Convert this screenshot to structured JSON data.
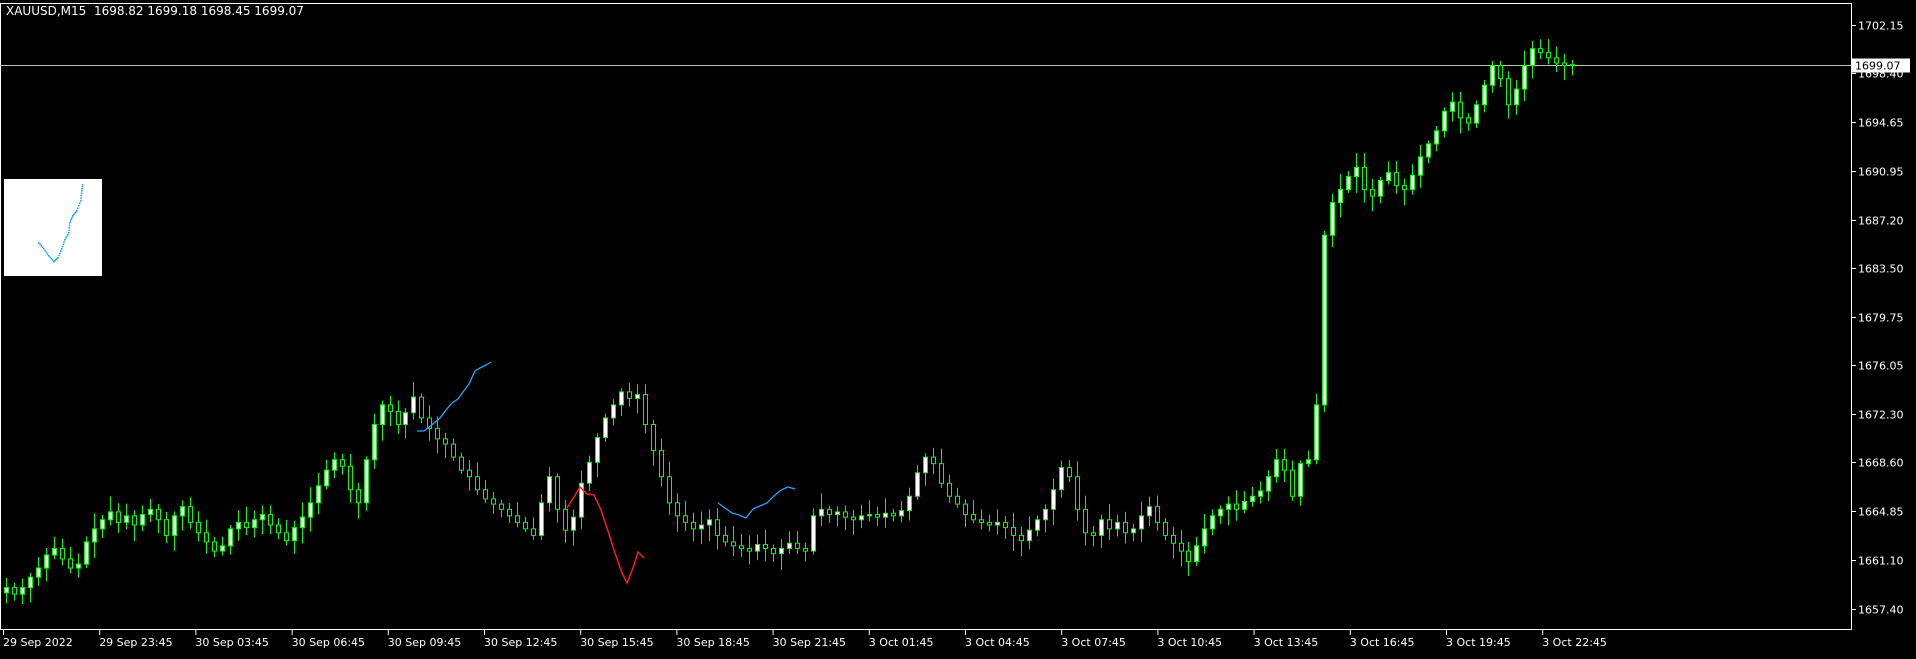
{
  "header": {
    "symbol_tf": "XAUUSD,M15",
    "open": "1698.82",
    "high": "1699.18",
    "low": "1698.45",
    "close": "1699.07"
  },
  "colors": {
    "background": "#000000",
    "axis": "#ffffff",
    "bull_body": "#ffffff",
    "bear_body": "#000000",
    "candle_outline": "#00ff00",
    "price_line": "#c0c0c0",
    "indicator_blue": "#1ea7ff",
    "indicator_red": "#ff1a1a",
    "thumbnail_bg": "#ffffff"
  },
  "chart_data": {
    "type": "candlestick",
    "ylim": [
      1654.0,
      1703.6
    ],
    "y_ticks": [
      "1702.15",
      "1698.40",
      "1694.65",
      "1690.95",
      "1687.20",
      "1683.50",
      "1679.75",
      "1676.05",
      "1672.30",
      "1668.60",
      "1664.85",
      "1661.10",
      "1657.40"
    ],
    "x_ticks": [
      "29 Sep 2022",
      "29 Sep 23:45",
      "30 Sep 03:45",
      "30 Sep 06:45",
      "30 Sep 09:45",
      "30 Sep 12:45",
      "30 Sep 15:45",
      "30 Sep 18:45",
      "30 Sep 21:45",
      "3 Oct 01:45",
      "3 Oct 04:45",
      "3 Oct 07:45",
      "3 Oct 10:45",
      "3 Oct 13:45",
      "3 Oct 16:45",
      "3 Oct 19:45",
      "3 Oct 22:45"
    ],
    "current_price": "1699.07",
    "close_series": [
      1659.0,
      1658.5,
      1659.0,
      1659.8,
      1660.5,
      1661.5,
      1662.0,
      1661.2,
      1660.5,
      1660.8,
      1662.5,
      1663.5,
      1664.2,
      1664.8,
      1664.0,
      1664.5,
      1663.8,
      1664.6,
      1665.0,
      1664.2,
      1663.0,
      1664.5,
      1665.2,
      1664.0,
      1663.2,
      1662.5,
      1661.8,
      1662.2,
      1663.5,
      1664.0,
      1663.6,
      1664.2,
      1664.6,
      1663.8,
      1663.2,
      1662.6,
      1663.6,
      1664.4,
      1665.5,
      1666.8,
      1668.0,
      1668.8,
      1668.3,
      1666.5,
      1665.5,
      1668.8,
      1671.5,
      1673.0,
      1672.5,
      1671.5,
      1672.4,
      1673.6,
      1672.0,
      1671.2,
      1670.4,
      1670.0,
      1669.0,
      1668.0,
      1667.5,
      1666.5,
      1665.8,
      1665.4,
      1665.0,
      1664.5,
      1664.0,
      1663.5,
      1663.0,
      1665.5,
      1667.5,
      1665.0,
      1663.4,
      1664.4,
      1667.0,
      1668.6,
      1670.5,
      1672.0,
      1673.0,
      1674.0,
      1673.5,
      1673.8,
      1671.5,
      1669.5,
      1667.5,
      1665.5,
      1664.5,
      1664.0,
      1663.5,
      1663.8,
      1664.2,
      1663.0,
      1662.5,
      1662.2,
      1662.0,
      1661.8,
      1662.3,
      1662.0,
      1661.6,
      1662.0,
      1662.4,
      1662.0,
      1661.8,
      1664.5,
      1665.0,
      1664.6,
      1664.8,
      1664.4,
      1664.2,
      1664.5,
      1664.6,
      1664.4,
      1664.7,
      1664.5,
      1664.9,
      1666.0,
      1667.8,
      1669.0,
      1668.5,
      1667.0,
      1666.0,
      1665.4,
      1664.6,
      1664.2,
      1664.0,
      1663.8,
      1664.0,
      1663.6,
      1663.0,
      1662.6,
      1663.4,
      1664.2,
      1665.0,
      1666.5,
      1668.2,
      1667.5,
      1665.0,
      1663.2,
      1663.0,
      1664.2,
      1663.5,
      1664.0,
      1663.2,
      1663.5,
      1664.5,
      1665.2,
      1664.0,
      1663.0,
      1662.4,
      1661.8,
      1661.0,
      1662.2,
      1663.5,
      1664.5,
      1665.0,
      1665.4,
      1665.0,
      1665.6,
      1666.0,
      1666.4,
      1667.5,
      1668.8,
      1668.0,
      1666.0,
      1668.5,
      1668.8,
      1673.0,
      1686.0,
      1688.5,
      1689.5,
      1690.5,
      1691.2,
      1689.5,
      1689.0,
      1690.2,
      1690.8,
      1689.8,
      1689.5,
      1690.6,
      1692.0,
      1693.0,
      1694.0,
      1695.5,
      1696.2,
      1695.0,
      1694.6,
      1696.0,
      1697.5,
      1699.0,
      1698.0,
      1696.0,
      1697.2,
      1699.0,
      1700.3,
      1700.0,
      1699.6,
      1699.2,
      1699.0,
      1699.07
    ]
  },
  "indicators": {
    "blue_segment_1": [
      [
        417,
        431
      ],
      [
        424,
        431
      ],
      [
        428,
        428
      ],
      [
        434,
        423
      ],
      [
        440,
        418
      ],
      [
        446,
        410
      ],
      [
        452,
        403
      ],
      [
        458,
        399
      ],
      [
        463,
        392
      ],
      [
        469,
        384
      ],
      [
        475,
        371
      ],
      [
        480,
        368
      ],
      [
        486,
        365
      ],
      [
        491,
        362
      ]
    ],
    "blue_segment_2": [
      [
        718,
        503
      ],
      [
        725,
        508
      ],
      [
        732,
        513
      ],
      [
        739,
        515
      ],
      [
        746,
        518
      ],
      [
        753,
        509
      ],
      [
        760,
        506
      ],
      [
        767,
        503
      ],
      [
        774,
        496
      ],
      [
        781,
        490
      ],
      [
        788,
        487
      ],
      [
        795,
        489
      ]
    ],
    "red_segment": [
      [
        567,
        508
      ],
      [
        574,
        497
      ],
      [
        580,
        487
      ],
      [
        587,
        494
      ],
      [
        594,
        495
      ],
      [
        601,
        510
      ],
      [
        608,
        531
      ],
      [
        615,
        553
      ],
      [
        622,
        573
      ],
      [
        627,
        583
      ],
      [
        633,
        568
      ],
      [
        638,
        552
      ],
      [
        644,
        558
      ]
    ],
    "thumbnail_dots": [
      [
        38,
        242
      ],
      [
        43,
        248
      ],
      [
        48,
        255
      ],
      [
        53,
        261
      ],
      [
        57,
        257
      ],
      [
        61,
        248
      ],
      [
        64,
        239
      ],
      [
        68,
        232
      ],
      [
        69,
        222
      ],
      [
        72,
        215
      ],
      [
        76,
        210
      ],
      [
        80,
        200
      ],
      [
        81,
        190
      ],
      [
        82,
        182
      ]
    ]
  }
}
